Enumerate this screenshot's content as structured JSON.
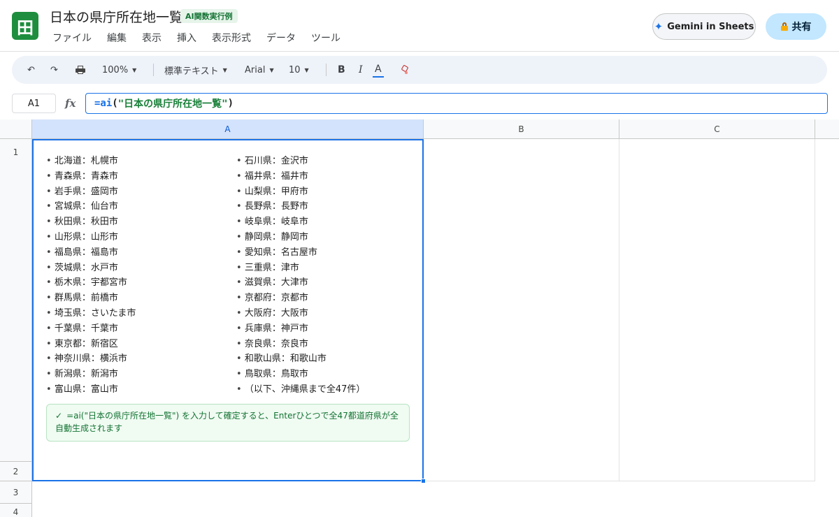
{
  "header": {
    "logo_glyph": "田",
    "title": "日本の県庁所在地一覧",
    "badge": "AI関数実行例",
    "menu": [
      "ファイル",
      "編集",
      "表示",
      "挿入",
      "表示形式",
      "データ",
      "ツール"
    ],
    "gemini_label": "Gemini in Sheets",
    "share_label": "共有"
  },
  "toolbar": {
    "undo_glyph": "↶",
    "redo_glyph": "↷",
    "zoom": "100%",
    "format": "標準テキスト",
    "font": "Arial",
    "font_size": "10",
    "bold": "B",
    "italic": "I",
    "text_color": "A",
    "icons": [
      "undo-icon",
      "redo-icon",
      "print-icon",
      "paint-format-icon"
    ]
  },
  "formula_bar": {
    "cell_ref": "A1",
    "fx": "fx",
    "fn": "=ai",
    "open": "(",
    "arg": "\"日本の県庁所在地一覧\"",
    "close": ")"
  },
  "grid": {
    "columns": [
      "A",
      "B",
      "C"
    ],
    "rows": [
      "1",
      "2",
      "3",
      "4"
    ]
  },
  "cell_a1": {
    "left_list": [
      "北海道：札幌市",
      "青森県：青森市",
      "岩手県：盛岡市",
      "宮城県：仙台市",
      "秋田県：秋田市",
      "山形県：山形市",
      "福島県：福島市",
      "茨城県：水戸市",
      "栃木県：宇都宮市",
      "群馬県：前橋市",
      "埼玉県：さいたま市",
      "千葉県：千葉市",
      "東京都：新宿区",
      "神奈川県：横浜市",
      "新潟県：新潟市",
      "富山県：富山市"
    ],
    "right_list": [
      "石川県：金沢市",
      "福井県：福井市",
      "山梨県：甲府市",
      "長野県：長野市",
      "岐阜県：岐阜市",
      "静岡県：静岡市",
      "愛知県：名古屋市",
      "三重県：津市",
      "滋賀県：大津市",
      "京都府：京都市",
      "大阪府：大阪市",
      "兵庫県：神戸市",
      "奈良県：奈良市",
      "和歌山県：和歌山市",
      "鳥取県：鳥取市",
      "（以下、沖縄県まで全47件）"
    ],
    "note_check": "✓",
    "note": "=ai(\"日本の県庁所在地一覧\") を入力して確定すると、Enterひとつで全47都道府県が全自動生成されます"
  },
  "colors": {
    "logo": "#1e8e3e",
    "accent": "#1a73e8",
    "share_bg": "#c2e7ff",
    "note_bg": "#f0fbf2",
    "note_text": "#137333"
  }
}
